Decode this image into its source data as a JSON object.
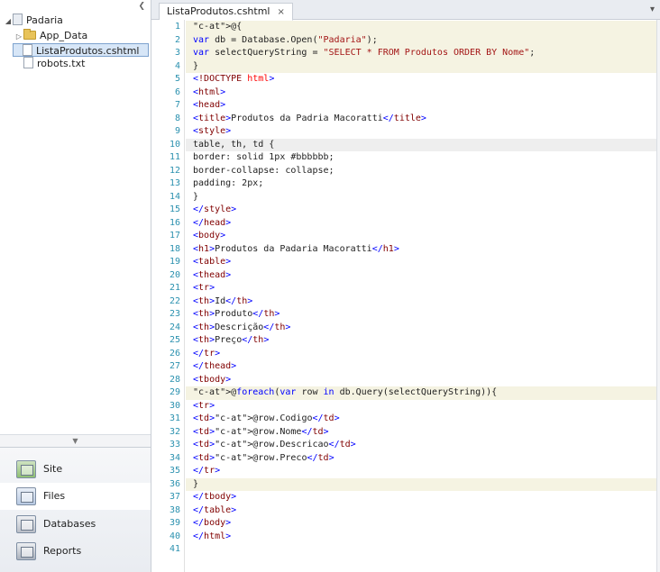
{
  "tree": {
    "root": "Padaria",
    "items": [
      {
        "label": "App_Data",
        "type": "folder"
      },
      {
        "label": "ListaProdutos.cshtml",
        "type": "file",
        "selected": true
      },
      {
        "label": "robots.txt",
        "type": "file"
      }
    ]
  },
  "workspaces": [
    {
      "label": "Site",
      "icon": "site-icon"
    },
    {
      "label": "Files",
      "icon": "files-icon",
      "active": true
    },
    {
      "label": "Databases",
      "icon": "databases-icon"
    },
    {
      "label": "Reports",
      "icon": "reports-icon"
    }
  ],
  "editor": {
    "tab_label": "ListaProdutos.cshtml",
    "tab_close": "×",
    "current_line": 10,
    "lines": [
      {
        "n": 1,
        "text": "@{",
        "razor": true
      },
      {
        "n": 2,
        "text": "var db = Database.Open(\"Padaria\");",
        "razor": true
      },
      {
        "n": 3,
        "text": "var selectQueryString = \"SELECT * FROM Produtos ORDER BY Nome\";",
        "razor": true
      },
      {
        "n": 4,
        "text": "}",
        "razor": true
      },
      {
        "n": 5,
        "text": "<!DOCTYPE html>"
      },
      {
        "n": 6,
        "text": "<html>"
      },
      {
        "n": 7,
        "text": "<head>"
      },
      {
        "n": 8,
        "text": "<title>Produtos da Padria Macoratti</title>"
      },
      {
        "n": 9,
        "text": "<style>"
      },
      {
        "n": 10,
        "text": "table, th, td {"
      },
      {
        "n": 11,
        "text": "border: solid 1px #bbbbbb;"
      },
      {
        "n": 12,
        "text": "border-collapse: collapse;"
      },
      {
        "n": 13,
        "text": "padding: 2px;"
      },
      {
        "n": 14,
        "text": "}"
      },
      {
        "n": 15,
        "text": "</style>"
      },
      {
        "n": 16,
        "text": "</head>"
      },
      {
        "n": 17,
        "text": "<body>"
      },
      {
        "n": 18,
        "text": "<h1>Produtos da Padaria Macoratti</h1>"
      },
      {
        "n": 19,
        "text": "<table>"
      },
      {
        "n": 20,
        "text": "<thead>"
      },
      {
        "n": 21,
        "text": "<tr>"
      },
      {
        "n": 22,
        "text": "<th>Id</th>"
      },
      {
        "n": 23,
        "text": "<th>Produto</th>"
      },
      {
        "n": 24,
        "text": "<th>Descrição</th>"
      },
      {
        "n": 25,
        "text": "<th>Preço</th>"
      },
      {
        "n": 26,
        "text": "</tr>"
      },
      {
        "n": 27,
        "text": "</thead>"
      },
      {
        "n": 28,
        "text": "<tbody>"
      },
      {
        "n": 29,
        "text": "@foreach(var row in db.Query(selectQueryString)){",
        "razor": true
      },
      {
        "n": 30,
        "text": "<tr>"
      },
      {
        "n": 31,
        "text": "<td>@row.Codigo</td>"
      },
      {
        "n": 32,
        "text": "<td>@row.Nome</td>"
      },
      {
        "n": 33,
        "text": "<td>@row.Descricao</td>"
      },
      {
        "n": 34,
        "text": "<td>@row.Preco</td>"
      },
      {
        "n": 35,
        "text": "</tr>"
      },
      {
        "n": 36,
        "text": "}",
        "razor": true
      },
      {
        "n": 37,
        "text": "</tbody>"
      },
      {
        "n": 38,
        "text": "</table>"
      },
      {
        "n": 39,
        "text": "</body>"
      },
      {
        "n": 40,
        "text": "</html>"
      },
      {
        "n": 41,
        "text": ""
      }
    ]
  }
}
